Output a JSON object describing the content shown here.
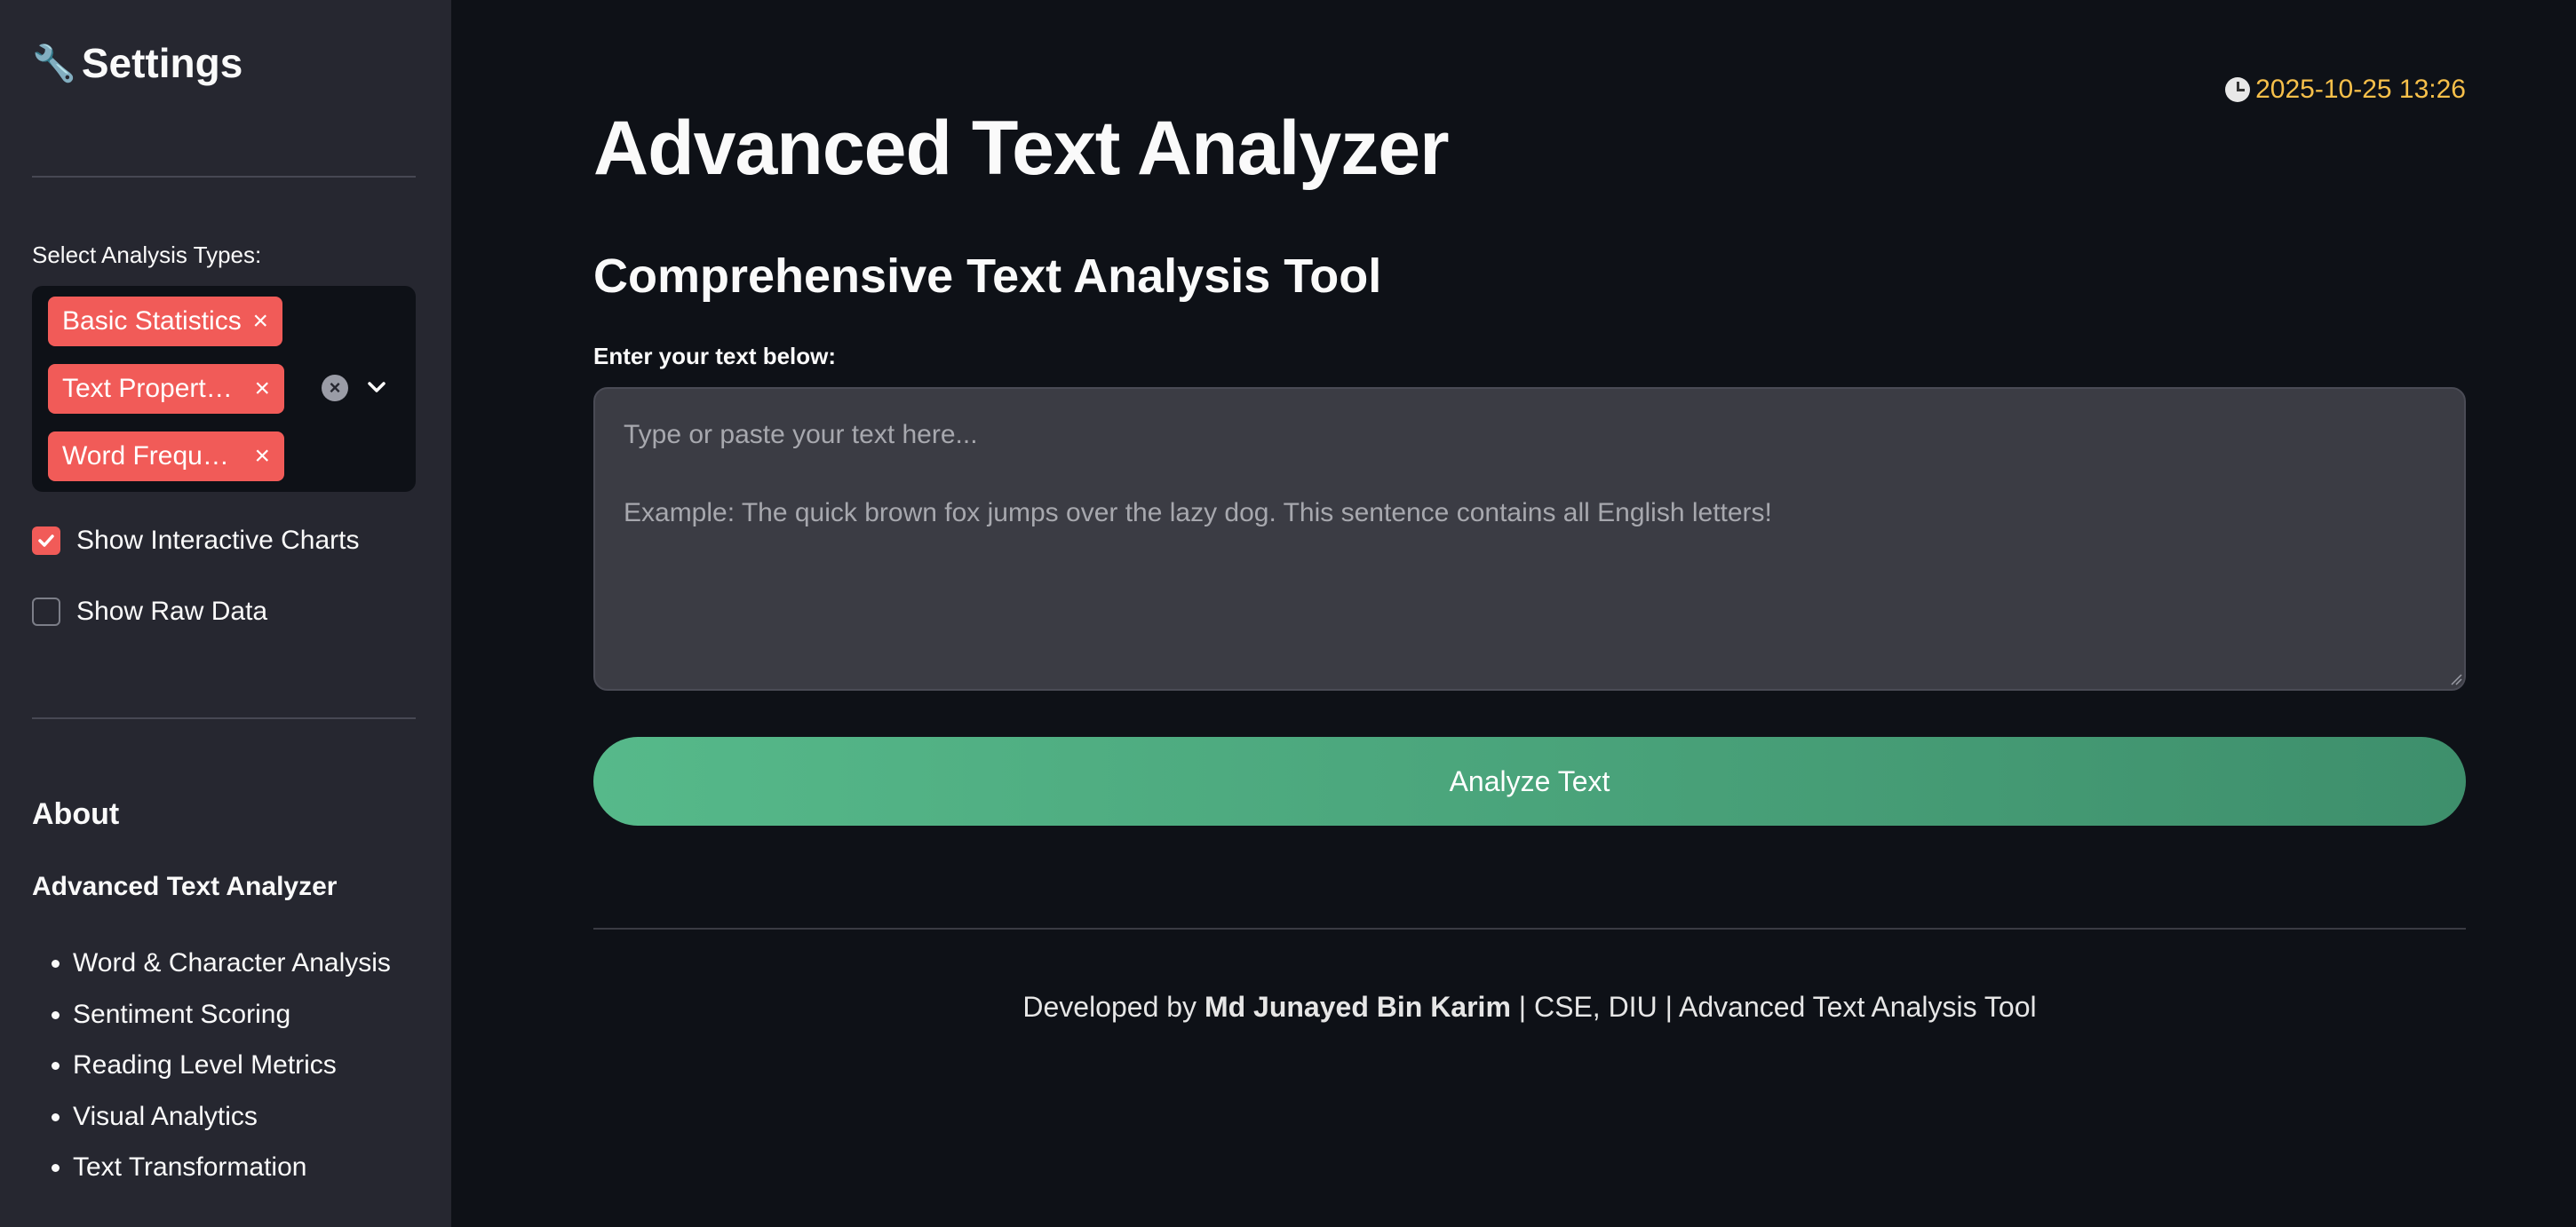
{
  "sidebar": {
    "title": "Settings",
    "title_icon": "wrench-icon",
    "analysis_label": "Select Analysis Types:",
    "selected_types": [
      "Basic Statistics",
      "Text Propert…",
      "Word Frequ…"
    ],
    "tag_remove_glyph": "×",
    "clear_glyph": "×",
    "checkboxes": [
      {
        "label": "Show Interactive Charts",
        "checked": true
      },
      {
        "label": "Show Raw Data",
        "checked": false
      }
    ],
    "about": {
      "heading": "About",
      "app_name": "Advanced Text Analyzer",
      "features": [
        "Word & Character Analysis",
        "Sentiment Scoring",
        "Reading Level Metrics",
        "Visual Analytics",
        "Text Transformation"
      ]
    }
  },
  "main": {
    "timestamp": "2025-10-25 13:26",
    "title": "Advanced Text Analyzer",
    "subtitle": "Comprehensive Text Analysis Tool",
    "input_label": "Enter your text below:",
    "input_value": "",
    "input_placeholder": "Type or paste your text here...\n\nExample: The quick brown fox jumps over the lazy dog. This sentence contains all English letters!",
    "button_label": "Analyze Text",
    "footer": {
      "prefix": "Developed by ",
      "author": "Md Junayed Bin Karim",
      "suffix": " | CSE, DIU | Advanced Text Analysis Tool"
    }
  },
  "colors": {
    "background": "#0e1117",
    "sidebar": "#262730",
    "accent": "#f15b58",
    "button_start": "#56b98a",
    "button_end": "#3e8f6c",
    "timestamp": "#f7c04a"
  }
}
